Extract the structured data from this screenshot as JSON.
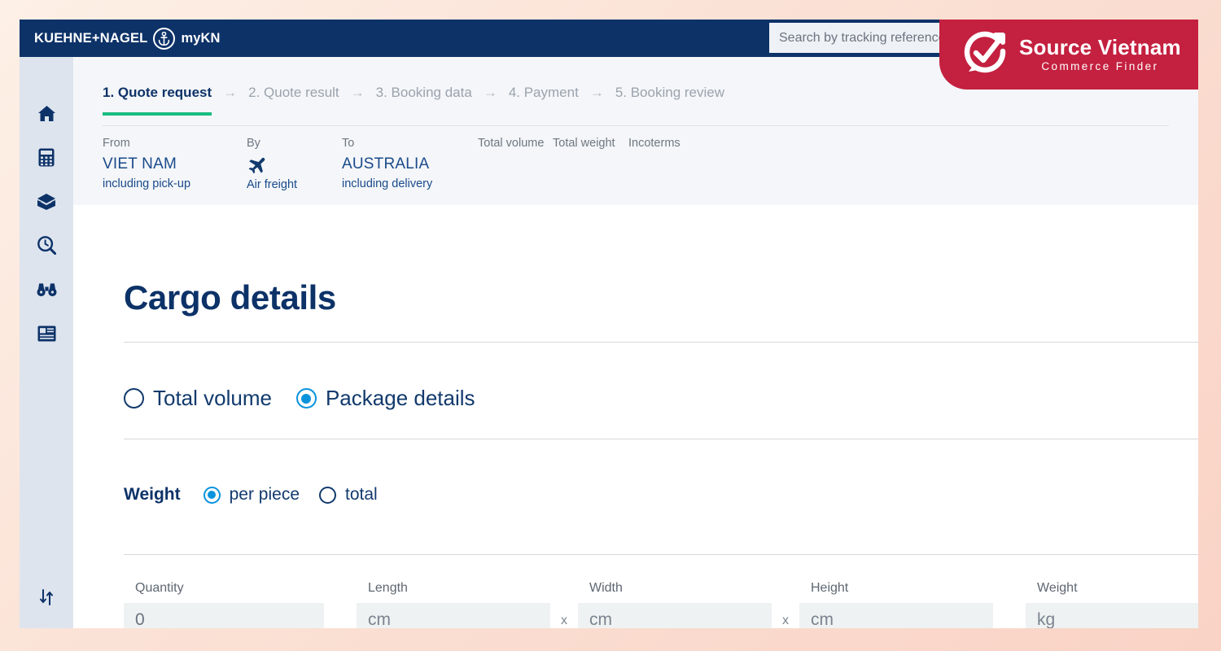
{
  "header": {
    "brand_kn": "KUEHNE+NAGEL",
    "brand_anchor_icon": "anchor-icon",
    "brand_mykn": "myKN",
    "search_placeholder": "Search by tracking reference",
    "search_value": ""
  },
  "overlay_banner": {
    "title": "Source Vietnam",
    "subtitle": "Commerce Finder",
    "logo_icon": "check-arrow-circle-icon",
    "color": "#c4203f"
  },
  "sidebar": {
    "items": [
      {
        "name": "home-icon",
        "label": "Home"
      },
      {
        "name": "calculator-icon",
        "label": "Quotations"
      },
      {
        "name": "package-box-icon",
        "label": "Shipments"
      },
      {
        "name": "track-search-icon",
        "label": "Track"
      },
      {
        "name": "binoculars-icon",
        "label": "Visibility"
      },
      {
        "name": "news-document-icon",
        "label": "Documents"
      }
    ],
    "bottom_item": {
      "name": "collapse-toggle-icon",
      "label": "Toggle sidebar"
    }
  },
  "stepper": {
    "steps": [
      {
        "label": "1. Quote request",
        "active": true
      },
      {
        "label": "2. Quote result",
        "active": false
      },
      {
        "label": "3. Booking data",
        "active": false
      },
      {
        "label": "4. Payment",
        "active": false
      },
      {
        "label": "5. Booking review",
        "active": false
      }
    ],
    "arrow_glyph": "→",
    "active_underline_color": "#19bc7f"
  },
  "summary": {
    "from": {
      "label": "From",
      "value": "VIET NAM",
      "note": "including pick-up"
    },
    "by": {
      "label": "By",
      "icon": "airplane-icon",
      "note": "Air freight"
    },
    "to": {
      "label": "To",
      "value": "AUSTRALIA",
      "note": "including delivery"
    },
    "total_volume": {
      "label": "Total volume",
      "value": ""
    },
    "total_weight": {
      "label": "Total weight",
      "value": ""
    },
    "incoterms": {
      "label": "Incoterms",
      "value": ""
    }
  },
  "main": {
    "title": "Cargo details",
    "cargo_mode": {
      "options": [
        {
          "label": "Total volume",
          "selected": false
        },
        {
          "label": "Package details",
          "selected": true
        }
      ]
    },
    "weight_mode": {
      "caption": "Weight",
      "options": [
        {
          "label": "per piece",
          "selected": true
        },
        {
          "label": "total",
          "selected": false
        }
      ]
    },
    "fields": {
      "quantity": {
        "label": "Quantity",
        "value": "0",
        "placeholder": "0"
      },
      "length": {
        "label": "Length",
        "value": "",
        "placeholder": "cm"
      },
      "width": {
        "label": "Width",
        "value": "",
        "placeholder": "cm"
      },
      "height": {
        "label": "Height",
        "value": "",
        "placeholder": "cm"
      },
      "weight": {
        "label": "Weight",
        "value": "",
        "placeholder": "kg"
      },
      "separator": "x"
    }
  },
  "colors": {
    "brand_navy": "#0d3268",
    "accent_blue": "#0a93dd",
    "accent_green": "#19bc7f",
    "sidebar_bg": "#dde4ee",
    "strip_bg": "#f4f6f9",
    "input_bg": "#eef2f2"
  }
}
